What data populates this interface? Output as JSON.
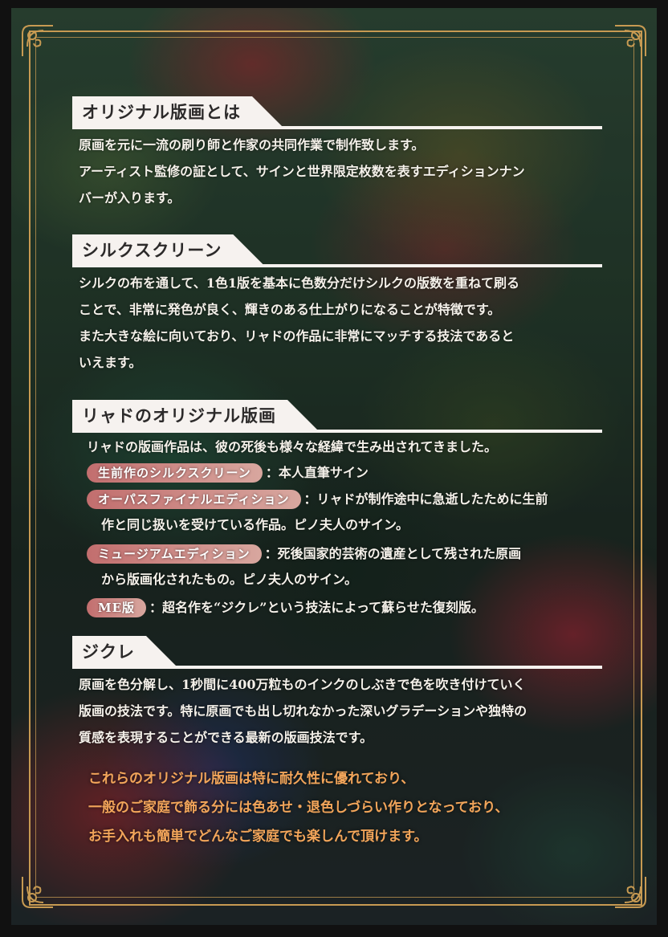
{
  "colors": {
    "frame_gold": "#c79a52",
    "heading_tab": "#f6f2ef",
    "body_text": "#f5f1ea",
    "pill_start": "#c26e6e",
    "pill_end": "#d8a79f",
    "closing_text": "#f2a55a"
  },
  "sections": [
    {
      "heading": "オリジナル版画とは",
      "lines": [
        "原画を元に一流の刷り師と作家の共同作業で制作致します。",
        "アーティスト監修の証として、サインと世界限定枚数を表すエディションナン",
        "バーが入ります。"
      ]
    },
    {
      "heading": "シルクスクリーン",
      "lines": [
        "シルクの布を通して、1色1版を基本に色数分だけシルクの版数を重ねて刷る",
        "ことで、非常に発色が良く、輝きのある仕上がりになることが特徴です。",
        "また大きな絵に向いており、リャドの作品に非常にマッチする技法であると",
        "いえます。"
      ]
    },
    {
      "heading": "リャドのオリジナル版画",
      "intro": "リャドの版画作品は、彼の死後も様々な経緯で生み出されてきました。",
      "definitions": [
        {
          "term": "生前作のシルクスクリーン",
          "text": "：本人直筆サイン",
          "cont": ""
        },
        {
          "term": "オーパスファイナルエディション",
          "text": "：リャドが制作途中に急逝したために生前",
          "cont": "作と同じ扱いを受けている作品。ピノ夫人のサイン。"
        },
        {
          "term": "ミュージアムエディション",
          "text": "：死後国家的芸術の遺産として残された原画",
          "cont": "から版画化されたもの。ピノ夫人のサイン。"
        },
        {
          "term": "ME版",
          "text": "：超名作を“ジクレ”という技法によって蘇らせた復刻版。",
          "cont": ""
        }
      ]
    },
    {
      "heading": "ジクレ",
      "lines": [
        "原画を色分解し、1秒間に400万粒ものインクのしぶきで色を吹き付けていく",
        "版画の技法です。特に原画でも出し切れなかった深いグラデーションや独特の",
        "質感を表現することができる最新の版画技法です。"
      ]
    }
  ],
  "closing": [
    "これらのオリジナル版画は特に耐久性に優れており、",
    "一般のご家庭で飾る分には色あせ・退色しづらい作りとなっており、",
    "お手入れも簡単でどんなご家庭でも楽しんで頂けます。"
  ]
}
